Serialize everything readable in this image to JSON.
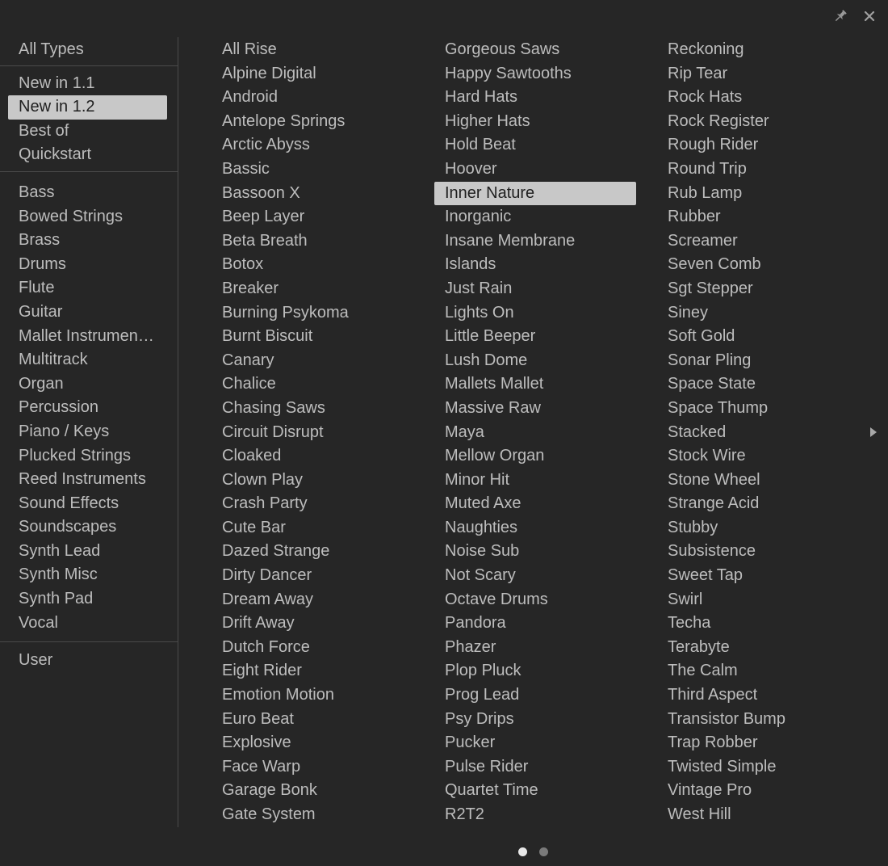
{
  "sidebar": {
    "groups": [
      {
        "items": [
          {
            "label": "All Types",
            "selected": false
          }
        ]
      },
      {
        "items": [
          {
            "label": "New in 1.1",
            "selected": false
          },
          {
            "label": "New in 1.2",
            "selected": true
          },
          {
            "label": "Best of",
            "selected": false
          },
          {
            "label": "Quickstart",
            "selected": false
          }
        ]
      },
      {
        "items": [
          {
            "label": "Bass",
            "selected": false
          },
          {
            "label": "Bowed Strings",
            "selected": false
          },
          {
            "label": "Brass",
            "selected": false
          },
          {
            "label": "Drums",
            "selected": false
          },
          {
            "label": "Flute",
            "selected": false
          },
          {
            "label": "Guitar",
            "selected": false
          },
          {
            "label": "Mallet Instrumen…",
            "selected": false
          },
          {
            "label": "Multitrack",
            "selected": false
          },
          {
            "label": "Organ",
            "selected": false
          },
          {
            "label": "Percussion",
            "selected": false
          },
          {
            "label": "Piano / Keys",
            "selected": false
          },
          {
            "label": "Plucked Strings",
            "selected": false
          },
          {
            "label": "Reed Instruments",
            "selected": false
          },
          {
            "label": "Sound Effects",
            "selected": false
          },
          {
            "label": "Soundscapes",
            "selected": false
          },
          {
            "label": "Synth Lead",
            "selected": false
          },
          {
            "label": "Synth Misc",
            "selected": false
          },
          {
            "label": "Synth Pad",
            "selected": false
          },
          {
            "label": "Vocal",
            "selected": false
          }
        ]
      },
      {
        "items": [
          {
            "label": "User",
            "selected": false
          }
        ]
      }
    ]
  },
  "presets": {
    "columns": [
      [
        "All Rise",
        "Alpine Digital",
        "Android",
        "Antelope Springs",
        "Arctic Abyss",
        "Bassic",
        "Bassoon X",
        "Beep Layer",
        "Beta Breath",
        "Botox",
        "Breaker",
        "Burning Psykoma",
        "Burnt Biscuit",
        "Canary",
        "Chalice",
        "Chasing Saws",
        "Circuit Disrupt",
        "Cloaked",
        "Clown Play",
        "Crash Party",
        "Cute Bar",
        "Dazed Strange",
        "Dirty Dancer",
        "Dream Away",
        "Drift Away",
        "Dutch Force",
        "Eight Rider",
        "Emotion Motion",
        "Euro Beat",
        "Explosive",
        "Face Warp",
        "Garage Bonk",
        "Gate System"
      ],
      [
        "Gorgeous Saws",
        "Happy Sawtooths",
        "Hard Hats",
        "Higher Hats",
        "Hold Beat",
        "Hoover",
        "Inner Nature",
        "Inorganic",
        "Insane Membrane",
        "Islands",
        "Just Rain",
        "Lights On",
        "Little Beeper",
        "Lush Dome",
        "Mallets Mallet",
        "Massive Raw",
        "Maya",
        "Mellow Organ",
        "Minor Hit",
        "Muted Axe",
        "Naughties",
        "Noise Sub",
        "Not Scary",
        "Octave Drums",
        "Pandora",
        "Phazer",
        "Plop Pluck",
        "Prog Lead",
        "Psy Drips",
        "Pucker",
        "Pulse Rider",
        "Quartet Time",
        "R2T2"
      ],
      [
        "Reckoning",
        "Rip Tear",
        "Rock Hats",
        "Rock Register",
        "Rough Rider",
        "Round Trip",
        "Rub Lamp",
        "Rubber",
        "Screamer",
        "Seven Comb",
        "Sgt Stepper",
        "Siney",
        "Soft Gold",
        "Sonar Pling",
        "Space State",
        "Space Thump",
        "Stacked",
        "Stock Wire",
        "Stone Wheel",
        "Strange Acid",
        "Stubby",
        "Subsistence",
        "Sweet Tap",
        "Swirl",
        "Techa",
        "Terabyte",
        "The Calm",
        "Third Aspect",
        "Transistor Bump",
        "Trap Robber",
        "Twisted Simple",
        "Vintage Pro",
        "West Hill"
      ]
    ],
    "selected": "Inner Nature"
  },
  "window_icons": [
    "pin-icon",
    "close-icon"
  ],
  "pager": {
    "pages": 2,
    "current": 1
  },
  "colors": {
    "background": "#262626",
    "text": "#bdbdbd",
    "selection_bg": "#c8c8c8",
    "selection_text": "#1f1f1f",
    "divider": "#4a4a4a"
  }
}
